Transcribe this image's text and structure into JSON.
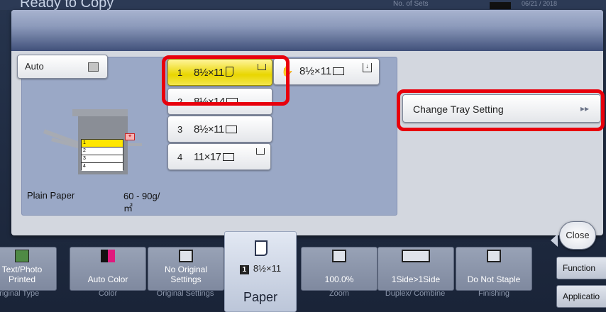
{
  "header": {
    "title": "Ready to Copy",
    "sets_label": "No. of Sets",
    "date": "06/21 / 2018"
  },
  "dialog": {
    "auto_label": "Auto",
    "trays": [
      {
        "number": "1",
        "size": "8½×11"
      },
      {
        "number": "2",
        "size": "8½×14"
      },
      {
        "number": "3",
        "size": "8½×11"
      },
      {
        "number": "4",
        "size": "11×17"
      }
    ],
    "bypass_size": "8½×11",
    "change_tray_label": "Change Tray Setting",
    "paper_type": "Plain Paper",
    "paper_weight": "60 - 90g/㎡",
    "machine_trays": [
      "1",
      "2",
      "3",
      "4"
    ]
  },
  "bottom": {
    "functions": [
      {
        "label": "Text/Photo Printed",
        "category": "Original Type"
      },
      {
        "label": "Auto Color",
        "category": "Color"
      },
      {
        "label": "No Original Settings",
        "category": "Original Settings"
      },
      {
        "label": "8½×11",
        "tray": "1",
        "category": "Paper"
      },
      {
        "label": "100.0%",
        "category": "Zoom"
      },
      {
        "label": "1Side>1Side",
        "category": "Duplex/ Combine"
      },
      {
        "label": "Do Not Staple",
        "category": "Finishing"
      }
    ],
    "close_label": "Close",
    "functions_label": "Function",
    "application_label": "Applicatio"
  },
  "colors": {
    "highlight": "#e8000c",
    "selected_tray": "#e9d600"
  }
}
